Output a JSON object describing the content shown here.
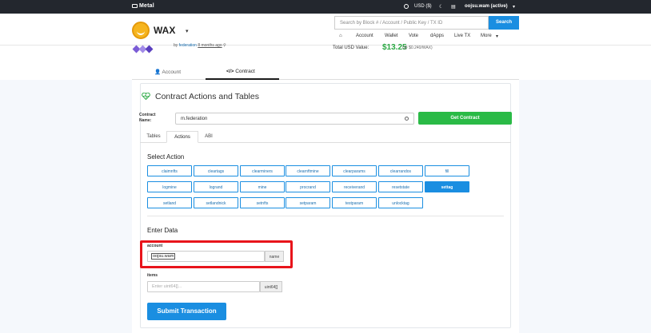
{
  "topbar": {
    "brand": "Metal",
    "currency": "USD ($)",
    "account": "oojsu.wam (active)"
  },
  "header": {
    "chain": "WAX",
    "search_placeholder": "Search by Block # / Account / Public Key / TX ID",
    "search_button": "Search",
    "nav": [
      "Account",
      "Wallet",
      "Vote",
      "dApps",
      "Live TX",
      "More"
    ]
  },
  "account_summary": {
    "by_prefix": "by",
    "by_account": "federation",
    "by_time": "8 months ago",
    "total_usd_label": "Total USD Value:",
    "total_usd_value": "$13.25",
    "total_usd_rate": "(@ $0.240/WAX)"
  },
  "main_tabs": [
    "Account",
    "Contract"
  ],
  "contract": {
    "title": "Contract Actions and Tables",
    "name_label_1": "Contract",
    "name_label_2": "Name:",
    "name_value": "m.federation",
    "get_button": "Get Contract",
    "subtabs": [
      "Tables",
      "Actions",
      "ABI"
    ],
    "select_action_title": "Select Action",
    "actions": [
      [
        "claimnfts",
        "cleartags",
        "clearminers",
        "clearnftmine",
        "clearparams",
        "clearrandos",
        "fill"
      ],
      [
        "logmine",
        "logrand",
        "mine",
        "procrand",
        "receiverand",
        "resetstate",
        "settag"
      ],
      [
        "setland",
        "setlandnick",
        "setnfts",
        "setparam",
        "testparam",
        "unlocktag"
      ]
    ],
    "selected_action": "settag",
    "enter_data_title": "Enter Data",
    "fields": [
      {
        "label": "account",
        "value": "oojsu.wam",
        "placeholder": "",
        "type": "name"
      },
      {
        "label": "items",
        "value": "",
        "placeholder": "Enter uint64[]...",
        "type": "uint64[]"
      }
    ],
    "submit_button": "Submit Transaction"
  },
  "colors": {
    "accent": "#1a8ee1",
    "success": "#2aba46",
    "highlight": "#e8141b",
    "topbar": "#23272e"
  }
}
